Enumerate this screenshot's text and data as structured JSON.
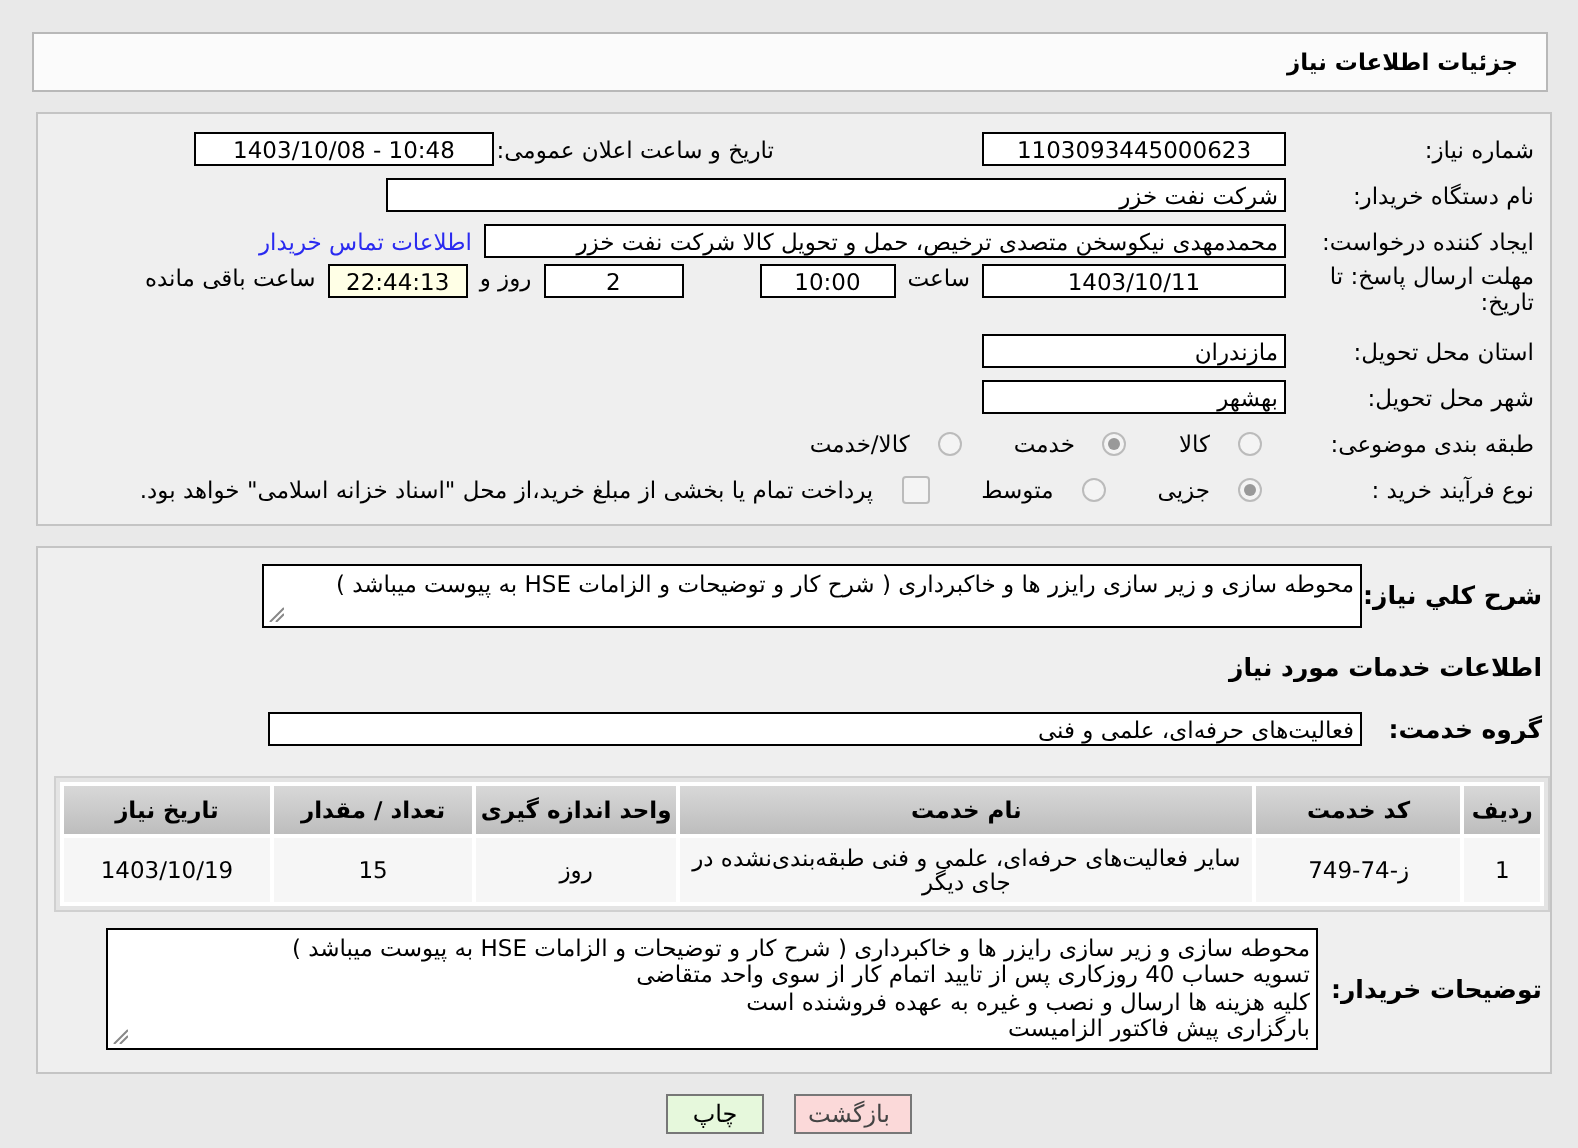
{
  "header": {
    "title": "جزئیات اطلاعات نیاز"
  },
  "need_number": {
    "label": "شماره نیاز:",
    "value": "1103093445000623"
  },
  "announce_datetime": {
    "label": "تاریخ و ساعت اعلان عمومی:",
    "value": "1403/10/08 - 10:48"
  },
  "buyer_org": {
    "label": "نام دستگاه خریدار:",
    "value": "شرکت نفت خزر"
  },
  "requester": {
    "label": "ایجاد کننده درخواست:",
    "value": "محمدمهدی نیکوسخن متصدی ترخیص، حمل و تحویل کالا شرکت نفت خزر",
    "contact_link": "اطلاعات تماس خریدار"
  },
  "deadline": {
    "label": "مهلت ارسال پاسخ: تا تاریخ:",
    "date": "1403/10/11",
    "time_label": "ساعت",
    "time": "10:00",
    "days": "2",
    "days_label": "روز و",
    "remaining": "22:44:13",
    "remaining_label": "ساعت باقی مانده"
  },
  "province": {
    "label": "استان محل تحویل:",
    "value": "مازندران"
  },
  "city": {
    "label": "شهر محل تحویل:",
    "value": "بهشهر"
  },
  "subject_category": {
    "label": "طبقه بندی موضوعی:",
    "disabled": true,
    "options": [
      {
        "label": "کالا",
        "selected": false
      },
      {
        "label": "خدمت",
        "selected": true
      },
      {
        "label": "کالا/خدمت",
        "selected": false
      }
    ]
  },
  "purchase_process": {
    "label": "نوع فرآیند خرید :",
    "disabled": true,
    "options": [
      {
        "label": "جزیی",
        "selected": true
      },
      {
        "label": "متوسط",
        "selected": false
      }
    ],
    "payment_option": {
      "label": "پرداخت تمام یا بخشی از مبلغ خرید،از محل \"اسناد خزانه اسلامی\" خواهد بود.",
      "checked": false
    }
  },
  "general_description": {
    "label": "شرح کلي نياز:",
    "value": "محوطه سازی و زیر سازی رایزر ها و خاکبرداری ( شرح کار و توضیحات و الزامات HSE  به پیوست میباشد )"
  },
  "services_heading": "اطلاعات خدمات مورد نیاز",
  "service_group": {
    "label": "گروه خدمت:",
    "value": "فعالیت‌های حرفه‌ای، علمی و فنی"
  },
  "table": {
    "columns": [
      "ردیف",
      "کد خدمت",
      "نام خدمت",
      "واحد اندازه گیری",
      "تعداد / مقدار",
      "تاریخ نیاز"
    ],
    "rows": [
      [
        "1",
        "ز-74-749",
        "سایر فعالیت‌های حرفه‌ای، علمی و فنی طبقه‌بندی‌نشده در جای دیگر",
        "روز",
        "15",
        "1403/10/19"
      ]
    ]
  },
  "buyer_notes": {
    "label": "توضیحات خریدار:",
    "lines": [
      "محوطه سازی و زیر سازی رایزر ها و خاکبرداری ( شرح کار و توضیحات و الزامات HSE  به پیوست میباشد )",
      "تسویه حساب 40 روزکاری پس از تایید اتمام کار از سوی واحد متقاضی",
      "کلیه هزینه ها ارسال و نصب و غیره به عهده فروشنده است",
      "بارگزاری پیش فاکتور الزامیست"
    ]
  },
  "buttons": [
    {
      "label": "بازگشت",
      "kind": "back"
    },
    {
      "label": "چاپ",
      "kind": "print"
    }
  ]
}
